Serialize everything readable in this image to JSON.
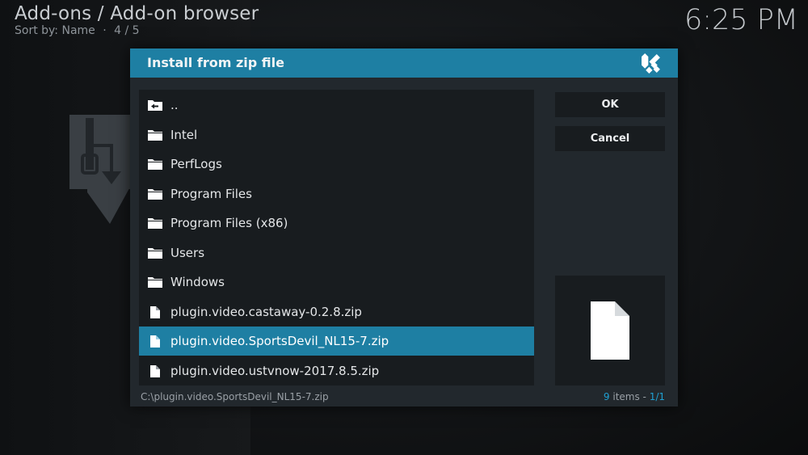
{
  "header": {
    "title": "Add-ons / Add-on browser",
    "sort_label": "Sort by: Name",
    "separator": "·",
    "position": "4 / 5"
  },
  "clock": "6:25 PM",
  "dialog": {
    "title": "Install from zip file",
    "ok_label": "OK",
    "cancel_label": "Cancel",
    "items": [
      {
        "label": "..",
        "icon": "folder-back-icon"
      },
      {
        "label": "Intel",
        "icon": "folder-icon"
      },
      {
        "label": "PerfLogs",
        "icon": "folder-icon"
      },
      {
        "label": "Program Files",
        "icon": "folder-icon"
      },
      {
        "label": "Program Files (x86)",
        "icon": "folder-icon"
      },
      {
        "label": "Users",
        "icon": "folder-icon"
      },
      {
        "label": "Windows",
        "icon": "folder-icon"
      },
      {
        "label": "plugin.video.castaway-0.2.8.zip",
        "icon": "file-icon"
      },
      {
        "label": "plugin.video.SportsDevil_NL15-7.zip",
        "icon": "file-icon",
        "selected": true
      },
      {
        "label": "plugin.video.ustvnow-2017.8.5.zip",
        "icon": "file-icon"
      }
    ],
    "path": "C:\\plugin.video.SportsDevil_NL15-7.zip",
    "items_count": "9",
    "items_label": " items - ",
    "page": "1/1"
  },
  "colors": {
    "accent": "#1e7fa3",
    "panel": "#22282d",
    "list_bg": "#181c1f"
  }
}
